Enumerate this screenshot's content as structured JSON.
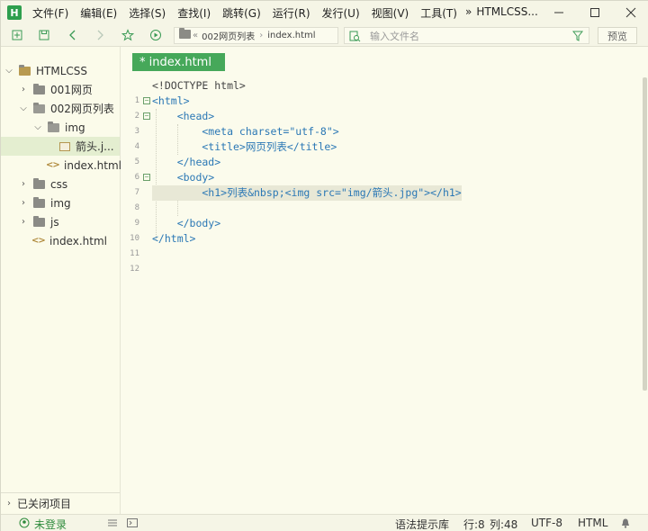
{
  "app": {
    "logo_letter": "H",
    "title": "HTMLCSS...",
    "accent": "#46a85a"
  },
  "menu": [
    "文件(F)",
    "编辑(E)",
    "选择(S)",
    "查找(I)",
    "跳转(G)",
    "运行(R)",
    "发行(U)",
    "视图(V)",
    "工具(T)"
  ],
  "toolbar": {
    "breadcrumb": [
      "002网页列表",
      "index.html"
    ],
    "search_placeholder": "输入文件名",
    "preview_label": "预览"
  },
  "sidebar": {
    "items": [
      {
        "label": "HTMLCSS",
        "type": "project"
      },
      {
        "label": "001网页",
        "type": "folder"
      },
      {
        "label": "002网页列表",
        "type": "folder-open"
      },
      {
        "label": "img",
        "type": "folder-open"
      },
      {
        "label": "箭头.j...",
        "type": "image",
        "selected": true
      },
      {
        "label": "index.html",
        "type": "file"
      },
      {
        "label": "css",
        "type": "folder"
      },
      {
        "label": "img",
        "type": "folder"
      },
      {
        "label": "js",
        "type": "folder"
      },
      {
        "label": "index.html",
        "type": "file"
      }
    ],
    "footer_label": "已关闭项目"
  },
  "editor": {
    "tab_label": "* index.html",
    "lines": [
      {
        "num": "1",
        "text": "<!DOCTYPE html>"
      },
      {
        "num": "2",
        "text": "<html>"
      },
      {
        "num": "3",
        "text": "    <head>"
      },
      {
        "num": "4",
        "text": "        <meta charset=\"utf-8\">"
      },
      {
        "num": "5",
        "text": "        <title>网页列表</title>"
      },
      {
        "num": "6",
        "text": "    </head>"
      },
      {
        "num": "7",
        "text": "    <body>"
      },
      {
        "num": "8",
        "text": "        <h1>列表&nbsp;<img src=\"img/箭头.jpg\"></h1>"
      },
      {
        "num": "9",
        "text": ""
      },
      {
        "num": "10",
        "text": "    </body>"
      },
      {
        "num": "11",
        "text": "</html>"
      },
      {
        "num": "12",
        "text": ""
      }
    ]
  },
  "status": {
    "login": "未登录",
    "hint_lib": "语法提示库",
    "row": "行:8",
    "col": "列:48",
    "encoding": "UTF-8",
    "language": "HTML"
  }
}
